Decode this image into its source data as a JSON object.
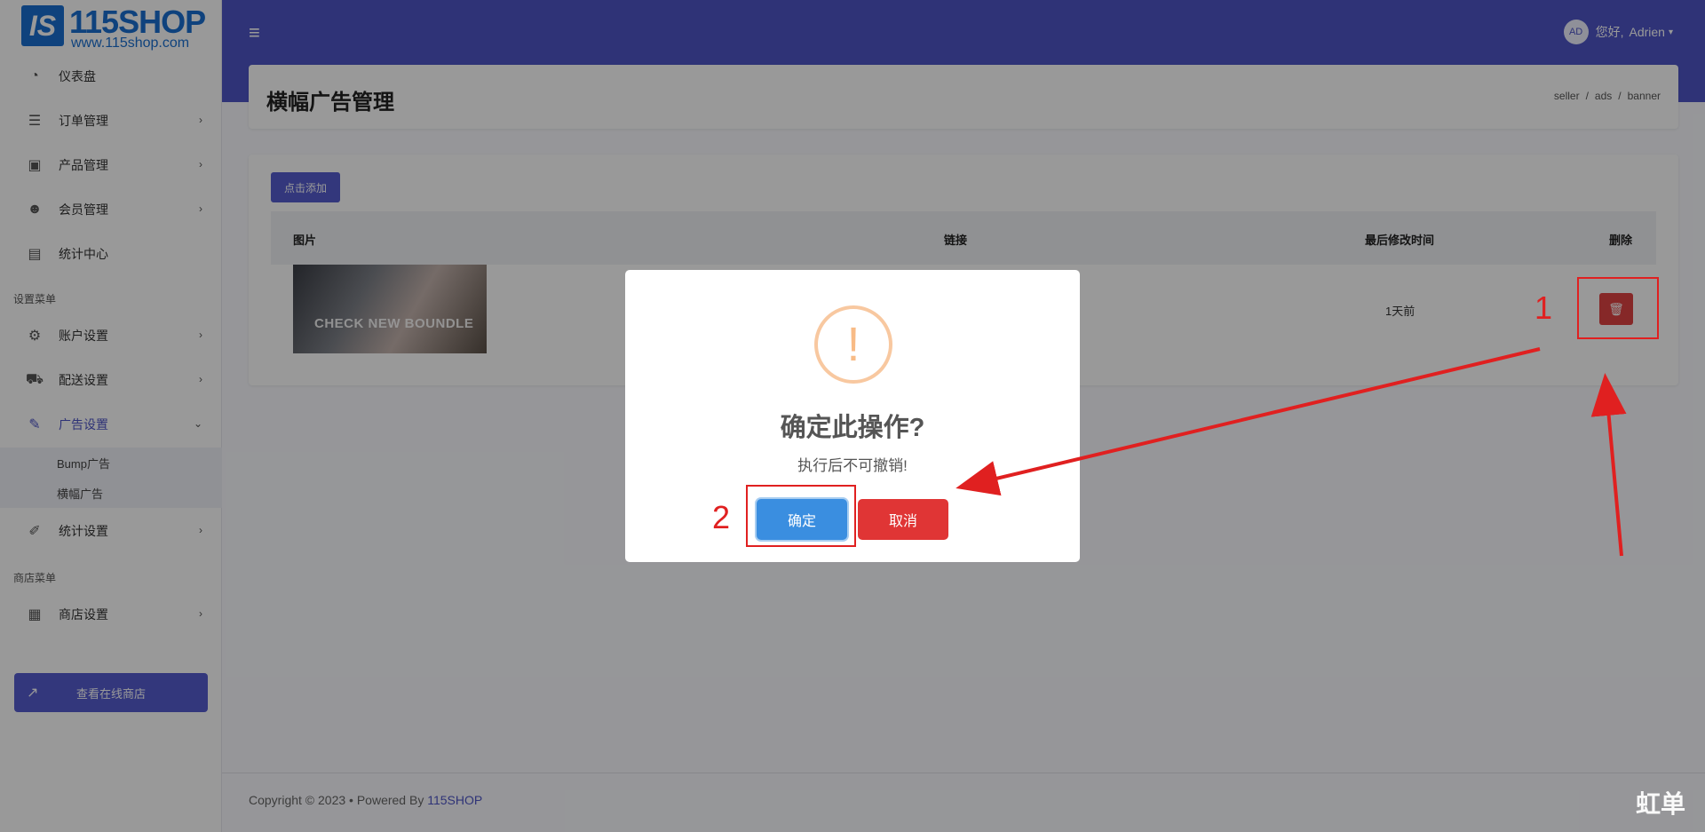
{
  "brand": {
    "logo_mark": "IS",
    "name": "115SHOP",
    "url": "www.115shop.com"
  },
  "sidebar": {
    "items": [
      {
        "label": "仪表盘",
        "icon": "dashboard-icon"
      },
      {
        "label": "订单管理",
        "icon": "orders-icon"
      },
      {
        "label": "产品管理",
        "icon": "products-icon"
      },
      {
        "label": "会员管理",
        "icon": "members-icon"
      },
      {
        "label": "统计中心",
        "icon": "stats-icon"
      },
      {
        "label": "账户设置",
        "icon": "gear-icon"
      },
      {
        "label": "配送设置",
        "icon": "truck-icon"
      },
      {
        "label": "广告设置",
        "icon": "megaphone-icon"
      },
      {
        "label": "统计设置",
        "icon": "chart-settings-icon"
      },
      {
        "label": "商店设置",
        "icon": "store-icon"
      }
    ],
    "section_settings": "设置菜单",
    "section_store": "商店菜单",
    "ads_sub": [
      "Bump广告",
      "横幅广告"
    ],
    "store_button": "查看在线商店"
  },
  "topbar": {
    "greeting": "您好,",
    "user_name": "Adrien",
    "avatar": "AD"
  },
  "header": {
    "title": "横幅广告管理",
    "breadcrumb": [
      "seller",
      "ads",
      "banner"
    ]
  },
  "table": {
    "add_button": "点击添加",
    "columns": [
      "图片",
      "链接",
      "最后修改时间",
      "删除"
    ],
    "rows": [
      {
        "image_caption": "CHECK NEW BOUNDLE",
        "link": "",
        "modified": "1天前"
      }
    ]
  },
  "modal": {
    "title": "确定此操作?",
    "text": "执行后不可撤销!",
    "confirm": "确定",
    "cancel": "取消",
    "icon": "!"
  },
  "annotations": {
    "step1": "1",
    "step2": "2"
  },
  "footer": {
    "copyright": "Copyright © 2023 • Powered By ",
    "brand": "115SHOP"
  },
  "watermark": "虹单"
}
